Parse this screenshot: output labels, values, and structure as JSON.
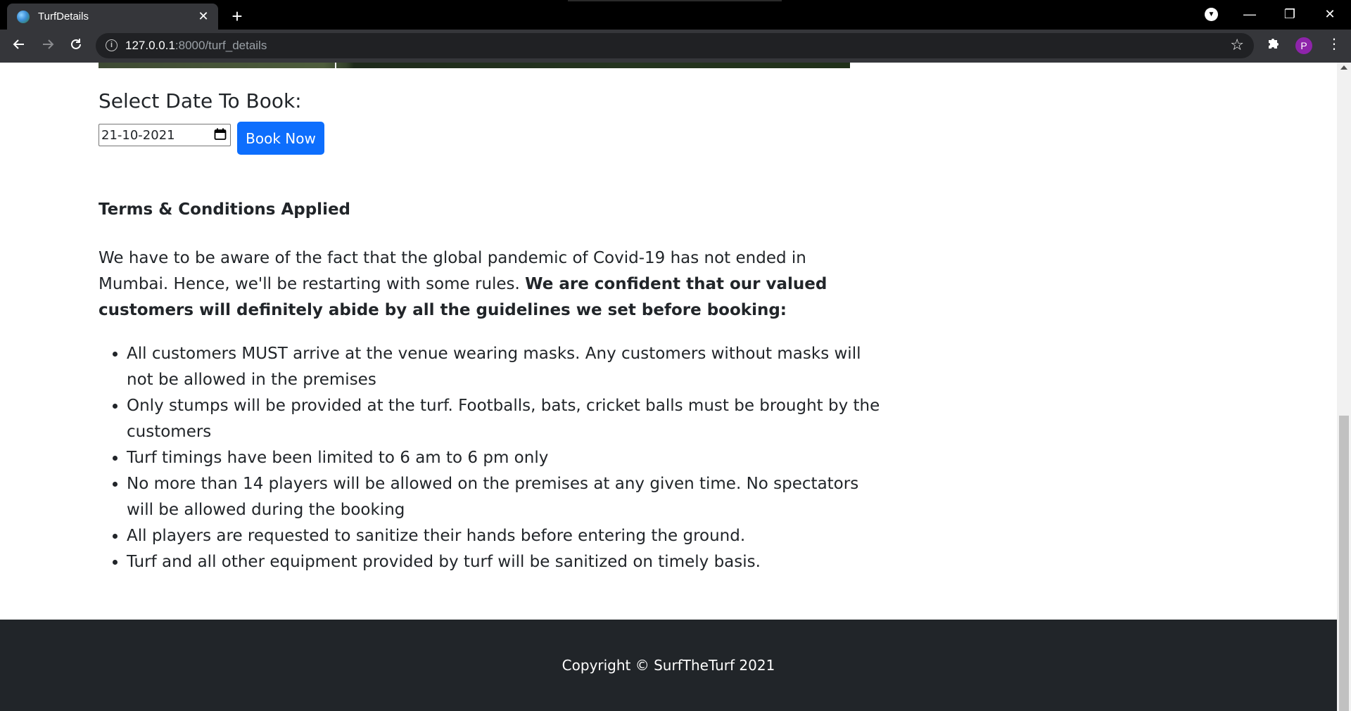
{
  "browser": {
    "tab_title": "TurfDetails",
    "tab_close": "✕",
    "new_tab": "+",
    "url_host": "127.0.0.1",
    "url_rest": ":8000/turf_details",
    "icons": {
      "back": "back-arrow-icon",
      "forward": "forward-arrow-icon",
      "reload": "reload-icon",
      "info": "info-icon",
      "bookmark": "star-icon",
      "extensions": "puzzle-icon",
      "menu": "kebab-menu-icon"
    },
    "avatar_letter": "P",
    "window_buttons": {
      "minimize": "—",
      "maximize": "❐",
      "close": "✕"
    }
  },
  "booking": {
    "heading": "Select Date To Book:",
    "date_value": "21-10-2021",
    "button_label": "Book Now"
  },
  "terms": {
    "heading": "Terms & Conditions Applied",
    "intro": "We have to be aware of the fact that the global pandemic of Covid-19 has not ended in Mumbai. Hence, we'll be restarting with some rules.",
    "intro_bold": "We are confident that our valued customers will definitely abide by all the guidelines we set before booking:",
    "rules": [
      "All customers MUST arrive at the venue wearing masks. Any customers without masks will not be allowed in the premises",
      "Only stumps will be provided at the turf. Footballs, bats, cricket balls must be brought by the customers",
      "Turf timings have been limited to 6 am to 6 pm only",
      "No more than 14 players will be allowed on the premises at any given time. No spectators will be allowed during the booking",
      "All players are requested to sanitize their hands before entering the ground.",
      "Turf and all other equipment provided by turf will be sanitized on timely basis."
    ]
  },
  "footer": {
    "copyright": "Copyright © SurfTheTurf 2021"
  },
  "colors": {
    "primary_button": "#0d6efd",
    "footer_bg": "#212529",
    "text": "#212529"
  }
}
